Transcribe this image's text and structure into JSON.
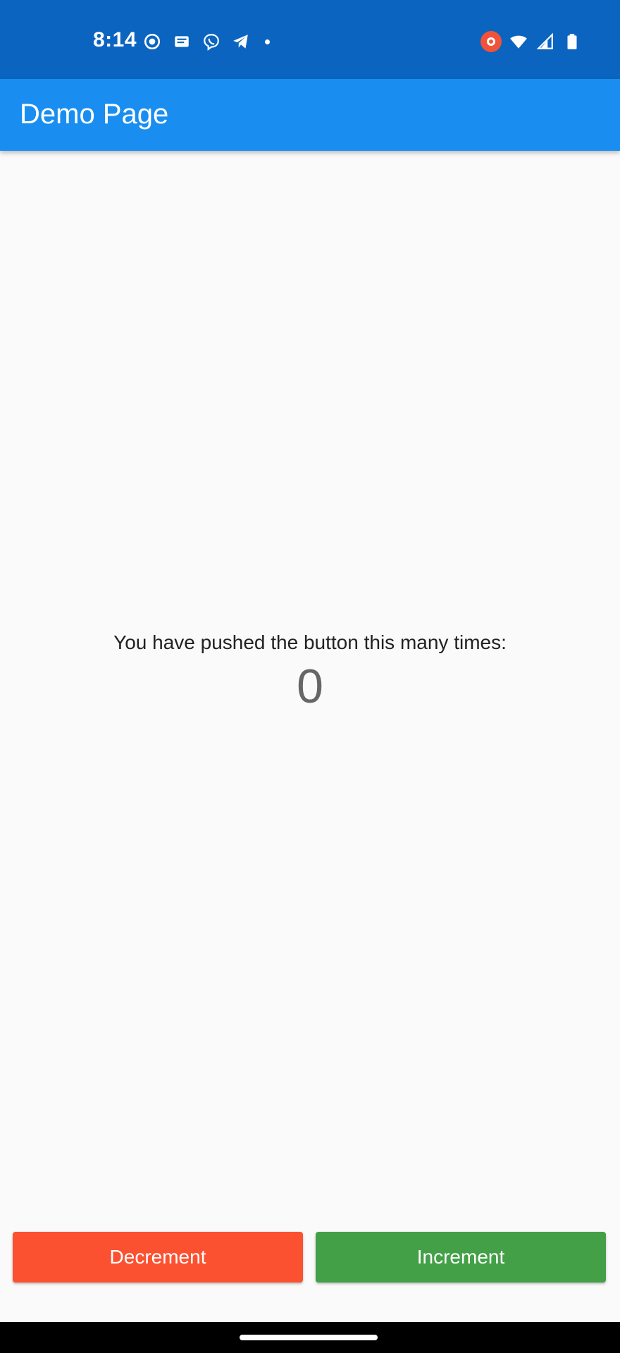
{
  "status_bar": {
    "time": "8:14",
    "left_icons": [
      "target-icon",
      "message-icon",
      "viber-icon",
      "telegram-icon",
      "dot-icon"
    ],
    "right_icons": [
      "screen-record-icon",
      "wifi-icon",
      "signal-icon",
      "battery-icon"
    ],
    "background": "#0b65c0"
  },
  "app_bar": {
    "title": "Demo Page",
    "background": "#1a8ef0"
  },
  "counter": {
    "label": "You have pushed the button this many times:",
    "value": "0"
  },
  "buttons": {
    "decrement_label": "Decrement",
    "increment_label": "Increment",
    "decrement_color": "#fc5130",
    "increment_color": "#43a047"
  }
}
